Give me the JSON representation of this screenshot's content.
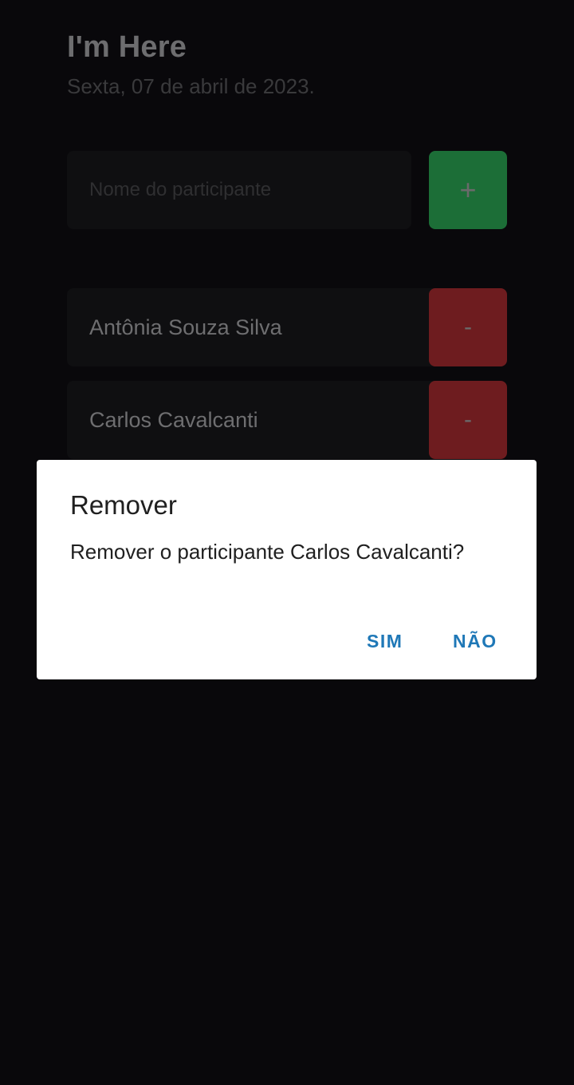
{
  "app": {
    "title": "I'm Here",
    "date": "Sexta, 07 de abril de 2023."
  },
  "form": {
    "placeholder": "Nome do participante",
    "add_label": "+"
  },
  "participants": [
    {
      "name": "Antônia Souza Silva",
      "remove_label": "-"
    },
    {
      "name": "Carlos Cavalcanti",
      "remove_label": "-"
    }
  ],
  "dialog": {
    "title": "Remover",
    "message": "Remover o participante Carlos Cavalcanti?",
    "confirm_label": "SIM",
    "cancel_label": "NÃO"
  },
  "colors": {
    "background": "#09080b",
    "add_button": "#1c6e37",
    "remove_button": "#6e1c1f",
    "dialog_action": "#1f78b7"
  }
}
